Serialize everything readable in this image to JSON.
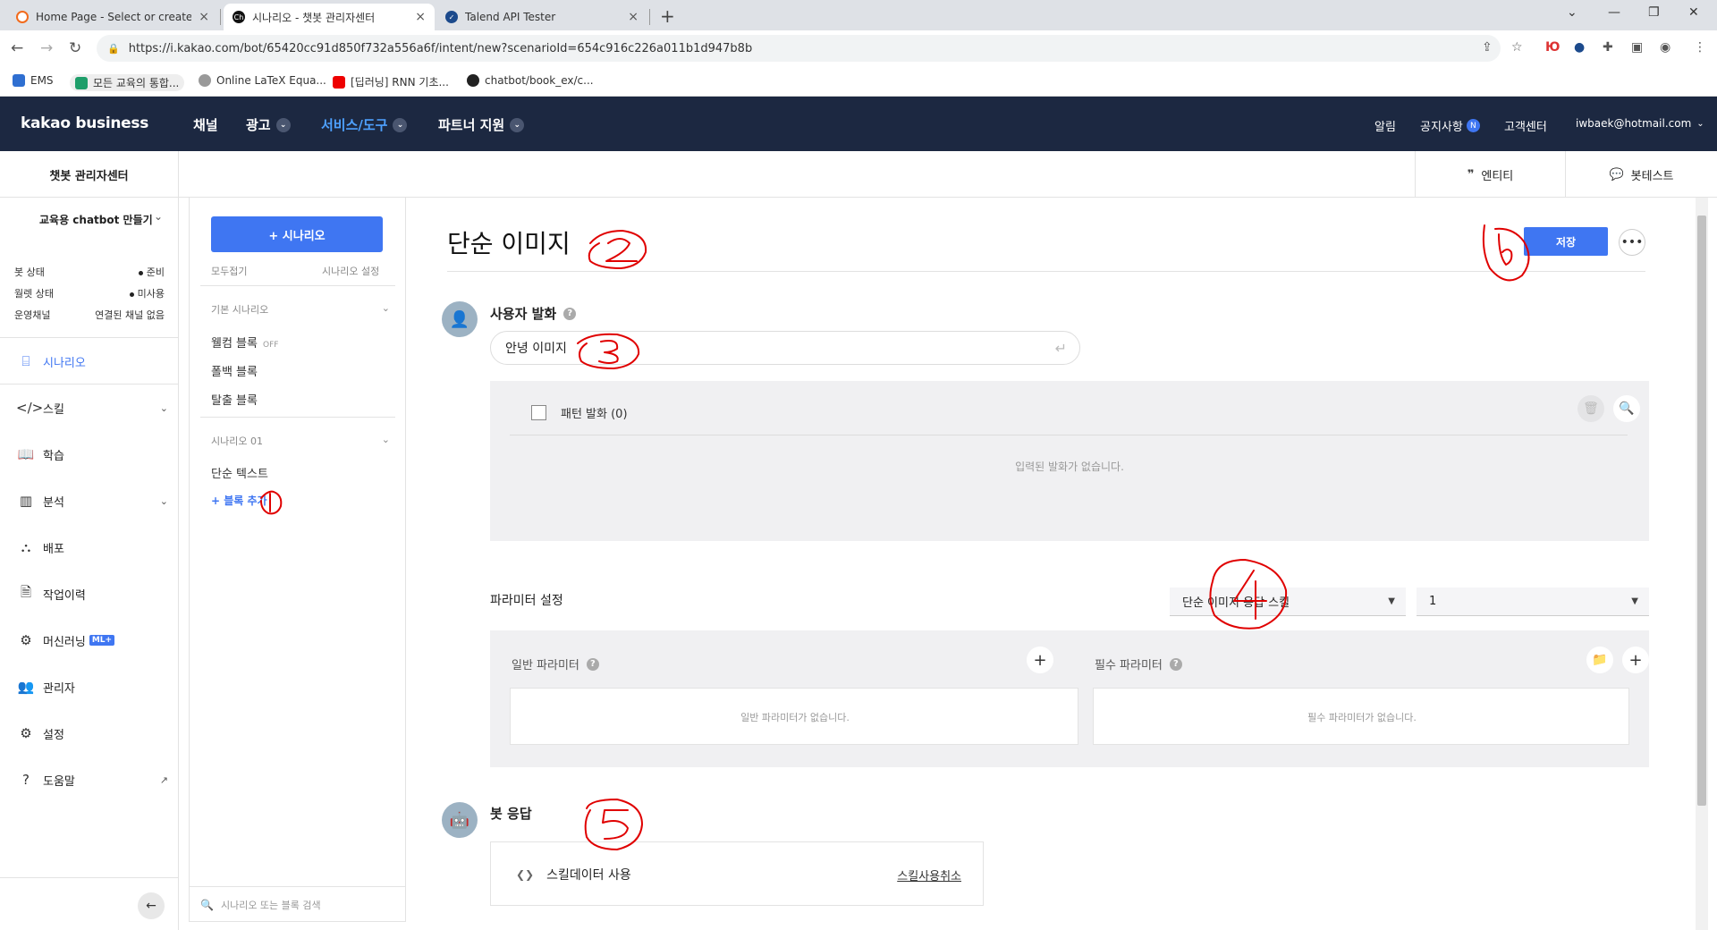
{
  "browser": {
    "tabs": [
      {
        "title": "Home Page - Select or create a"
      },
      {
        "title": "시나리오 - 챗봇 관리자센터"
      },
      {
        "title": "Talend API Tester"
      }
    ],
    "url": "https://i.kakao.com/bot/65420cc91d850f732a556a6f/intent/new?scenarioId=654c916c226a011b1d947b8b",
    "bookmarks": [
      "EMS",
      "모든 교육의 통합...",
      "Online LaTeX Equa...",
      "[딥러닝] RNN 기초...",
      "chatbot/book_ex/c..."
    ],
    "profile_text": "Ю"
  },
  "header": {
    "logo": "kakao business",
    "nav": [
      "채널",
      "광고",
      "서비스/도구",
      "파트너 지원"
    ],
    "right": {
      "alarm": "알림",
      "notice": "공지사항",
      "notice_badge": "N",
      "support": "고객센터",
      "account": "iwbaek@hotmail.com"
    }
  },
  "subheader": {
    "center_title": "챗봇 관리자센터",
    "entity_tab": "엔티티",
    "bottest_tab": "봇테스트"
  },
  "sidebar": {
    "bot_name": "교육용 chatbot 만들기",
    "status": [
      {
        "label": "봇 상태",
        "value": "준비"
      },
      {
        "label": "월렛 상태",
        "value": "미사용"
      },
      {
        "label": "운영채널",
        "value": "연결된 채널 없음"
      }
    ],
    "items": [
      {
        "label": "시나리오"
      },
      {
        "label": "스킬"
      },
      {
        "label": "학습"
      },
      {
        "label": "분석"
      },
      {
        "label": "배포"
      },
      {
        "label": "작업이력"
      },
      {
        "label": "머신러닝",
        "badge": "ML+"
      },
      {
        "label": "관리자"
      },
      {
        "label": "설정"
      },
      {
        "label": "도움말"
      }
    ]
  },
  "scenario_panel": {
    "add_button": "+ 시나리오",
    "collapse_all": "모두접기",
    "scenario_settings": "시나리오 설정",
    "default_group": "기본 시나리오",
    "default_items": [
      {
        "label": "웰컴 블록",
        "flag": "OFF"
      },
      {
        "label": "폴백 블록",
        "flag": ""
      },
      {
        "label": "탈출 블록",
        "flag": ""
      }
    ],
    "group2": "시나리오 01",
    "group2_items": [
      "단순 텍스트"
    ],
    "add_block": "+ 블록 추가",
    "search_placeholder": "시나리오 또는 블록 검색"
  },
  "editor": {
    "block_title": "단순 이미지",
    "save_button": "저장",
    "user_utterance": {
      "label": "사용자 발화",
      "input_value": "안녕 이미지",
      "pattern_label": "패턴 발화 (0)",
      "empty_text": "입력된 발화가 없습니다."
    },
    "params": {
      "label": "파라미터 설정",
      "skill_select": "단순 이미지 응답 스킬",
      "version_select": "1",
      "general_label": "일반 파라미터",
      "general_empty": "일반 파라미터가 없습니다.",
      "required_label": "필수 파라미터",
      "required_empty": "필수 파라미터가 없습니다."
    },
    "bot_response": {
      "label": "봇 응답",
      "skill_data": "스킬데이터 사용",
      "cancel": "스킬사용취소"
    }
  },
  "colors": {
    "header_bg": "#1c2841",
    "accent": "#3f76f2",
    "annotation": "#e00000"
  }
}
